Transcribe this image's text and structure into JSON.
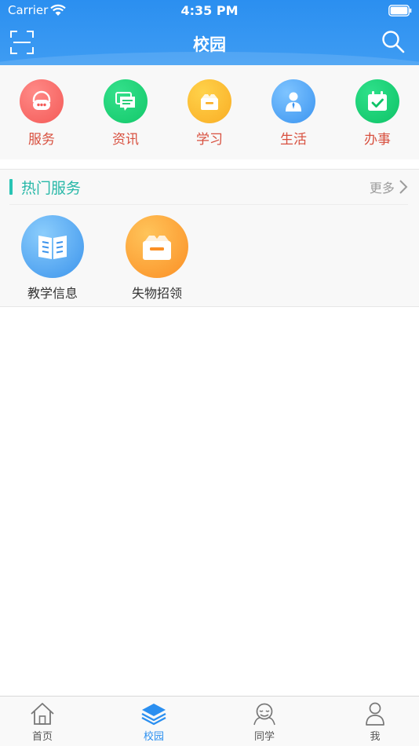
{
  "status_bar": {
    "carrier": "Carrier",
    "time": "4:35 PM"
  },
  "header": {
    "title": "校园"
  },
  "categories": [
    {
      "label": "服务",
      "icon": "headset-icon",
      "color": "#f45a57"
    },
    {
      "label": "资讯",
      "icon": "chat-icon",
      "color": "#13c86a"
    },
    {
      "label": "学习",
      "icon": "box-icon",
      "color": "#f9ad25"
    },
    {
      "label": "生活",
      "icon": "person-icon",
      "color": "#3b94f0"
    },
    {
      "label": "办事",
      "icon": "calendar-check-icon",
      "color": "#0fc367"
    }
  ],
  "hot_services": {
    "title": "热门服务",
    "more_label": "更多",
    "items": [
      {
        "label": "教学信息",
        "icon": "book-icon"
      },
      {
        "label": "失物招领",
        "icon": "box-icon"
      }
    ]
  },
  "tabbar": {
    "items": [
      {
        "label": "首页",
        "icon": "home-icon"
      },
      {
        "label": "校园",
        "icon": "layers-icon",
        "active": true
      },
      {
        "label": "同学",
        "icon": "classmates-icon"
      },
      {
        "label": "我",
        "icon": "user-icon"
      }
    ]
  },
  "colors": {
    "brand": "#2b8ff0",
    "accent": "#28c4b4",
    "category_label": "#d8503f"
  }
}
